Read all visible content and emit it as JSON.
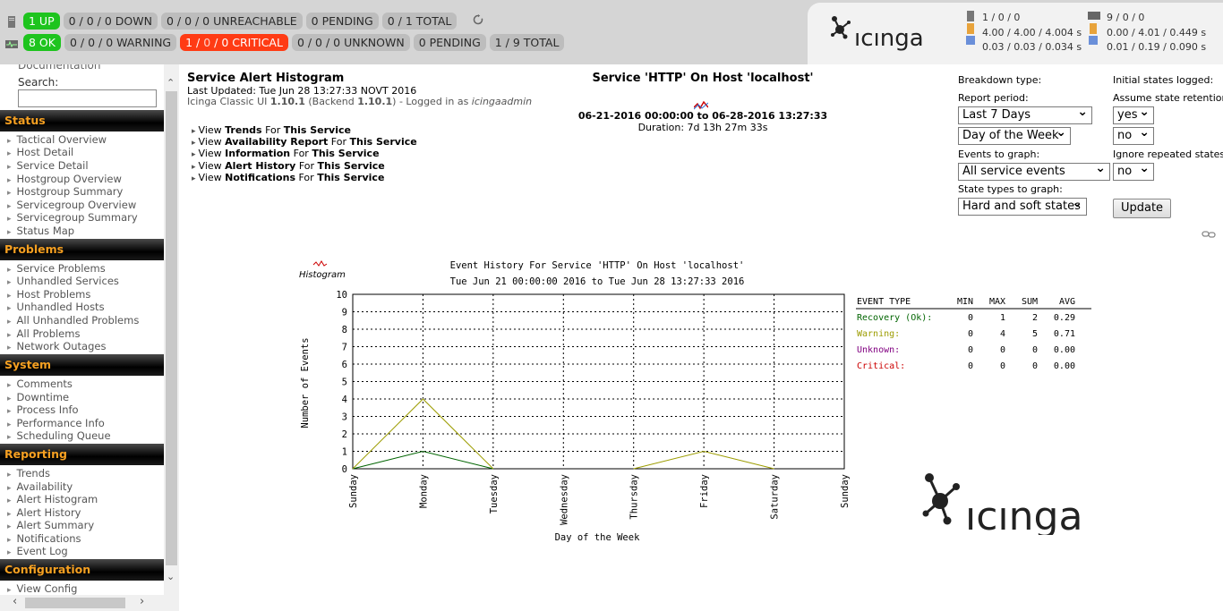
{
  "top": {
    "row1": {
      "up": "1 UP",
      "down": "0 / 0 / 0 DOWN",
      "unreachable": "0 / 0 / 0 UNREACHABLE",
      "pending": "0 PENDING",
      "total": "0 / 1 TOTAL"
    },
    "row2": {
      "ok": "8 OK",
      "warning": "0 / 0 / 0 WARNING",
      "critical_prefix": "1 / ",
      "critical_zero": "0",
      "critical_suffix": " / 0 CRITICAL",
      "unknown": "0 / 0 / 0 UNKNOWN",
      "pending": "0 PENDING",
      "total": "1 / 9 TOTAL"
    },
    "refresh_icon": "refresh-icon",
    "brand": "icinga",
    "host_stats": {
      "count": "1 / 0 / 0",
      "exec": "4.00 / 4.00 / 4.004 s",
      "latency": "0.03 / 0.03 / 0.034 s"
    },
    "service_stats": {
      "count": "9 / 0 / 0",
      "exec": "0.00 / 4.01 / 0.449 s",
      "latency": "0.01 / 0.19 / 0.090 s"
    }
  },
  "sidebar": {
    "doc": "Documentation",
    "search_label": "Search:",
    "sections": [
      {
        "title": "Status",
        "items": [
          "Tactical Overview",
          "Host Detail",
          "Service Detail",
          "Hostgroup Overview",
          "Hostgroup Summary",
          "Servicegroup Overview",
          "Servicegroup Summary",
          "Status Map"
        ]
      },
      {
        "title": "Problems",
        "items": [
          "Service Problems",
          "Unhandled Services",
          "Host Problems",
          "Unhandled Hosts",
          "All Unhandled Problems",
          "All Problems",
          "Network Outages"
        ]
      },
      {
        "title": "System",
        "items": [
          "Comments",
          "Downtime",
          "Process Info",
          "Performance Info",
          "Scheduling Queue"
        ]
      },
      {
        "title": "Reporting",
        "items": [
          "Trends",
          "Availability",
          "Alert Histogram",
          "Alert History",
          "Alert Summary",
          "Notifications",
          "Event Log"
        ]
      },
      {
        "title": "Configuration",
        "items": [
          "View Config"
        ]
      }
    ]
  },
  "main": {
    "title": "Service Alert Histogram",
    "last_updated": "Last Updated: Tue Jun 28 13:27:33 NOVT 2016",
    "version_prefix": "Icinga Classic UI ",
    "version": "1.10.1",
    "backend_prefix": " (Backend ",
    "backend": "1.10.1",
    "logged_in_prefix": ") - Logged in as ",
    "user": "icingaadmin",
    "links": [
      {
        "a": "View ",
        "b": "Trends",
        "c": " For ",
        "d": "This Service"
      },
      {
        "a": "View ",
        "b": "Availability Report",
        "c": " For ",
        "d": "This Service"
      },
      {
        "a": "View ",
        "b": "Information",
        "c": " For ",
        "d": "This Service"
      },
      {
        "a": "View ",
        "b": "Alert History",
        "c": " For ",
        "d": "This Service"
      },
      {
        "a": "View ",
        "b": "Notifications",
        "c": " For ",
        "d": "This Service"
      }
    ],
    "service_title": "Service 'HTTP' On Host 'localhost'",
    "period": "06-21-2016 00:00:00 to 06-28-2016 13:27:33",
    "duration": "Duration: 7d 13h 27m 33s"
  },
  "form": {
    "breakdown_label": "Breakdown type:",
    "report_period_label": "Report period:",
    "report_period_value": "Last 7 Days",
    "breakdown_value": "Day of the Week",
    "events_label": "Events to graph:",
    "events_value": "All service events",
    "state_types_label": "State types to graph:",
    "state_types_value": "Hard and soft states",
    "initial_states_label": "Initial states logged:",
    "assume_label": "Assume state retention:",
    "initial_value": "yes",
    "assume_value": "no",
    "ignore_label": "Ignore repeated states:",
    "ignore_value": "no",
    "update_label": "Update"
  },
  "chart_data": {
    "type": "line",
    "title": "Event History For Service 'HTTP' On Host 'localhost'",
    "subtitle": "Tue Jun 21 00:00:00 2016 to Tue Jun 28 13:27:33 2016",
    "side_label": "Histogram",
    "xlabel": "Day of the Week",
    "ylabel": "Number of Events",
    "ylim": [
      0,
      10
    ],
    "yticks": [
      "0",
      "1",
      "2",
      "3",
      "4",
      "5",
      "6",
      "7",
      "8",
      "9",
      "10"
    ],
    "categories": [
      "Sunday",
      "Monday",
      "Tuesday",
      "Wednesday",
      "Thursday",
      "Friday",
      "Saturday",
      "Sunday"
    ],
    "grid": true,
    "series": [
      {
        "name": "Recovery (Ok):",
        "color": "#006400",
        "values": [
          0,
          1,
          0,
          null,
          null,
          null,
          null,
          null
        ]
      },
      {
        "name": "Warning:",
        "color": "#9c9c00",
        "values": [
          0,
          4,
          0,
          null,
          0,
          1,
          0,
          null
        ]
      },
      {
        "name": "Unknown:",
        "color": "#800080",
        "values": [
          null,
          null,
          null,
          null,
          null,
          null,
          null,
          null
        ]
      },
      {
        "name": "Critical:",
        "color": "#cc0000",
        "values": [
          null,
          null,
          null,
          null,
          null,
          null,
          null,
          null
        ]
      }
    ],
    "table": {
      "headers": [
        "EVENT TYPE",
        "MIN",
        "MAX",
        "SUM",
        "AVG"
      ],
      "rows": [
        {
          "label": "Recovery (Ok):",
          "color": "#006400",
          "min": "0",
          "max": "1",
          "sum": "2",
          "avg": "0.29"
        },
        {
          "label": "Warning:",
          "color": "#9c9c00",
          "min": "0",
          "max": "4",
          "sum": "5",
          "avg": "0.71"
        },
        {
          "label": "Unknown:",
          "color": "#800080",
          "min": "0",
          "max": "0",
          "sum": "0",
          "avg": "0.00"
        },
        {
          "label": "Critical:",
          "color": "#cc0000",
          "min": "0",
          "max": "0",
          "sum": "0",
          "avg": "0.00"
        }
      ]
    }
  }
}
